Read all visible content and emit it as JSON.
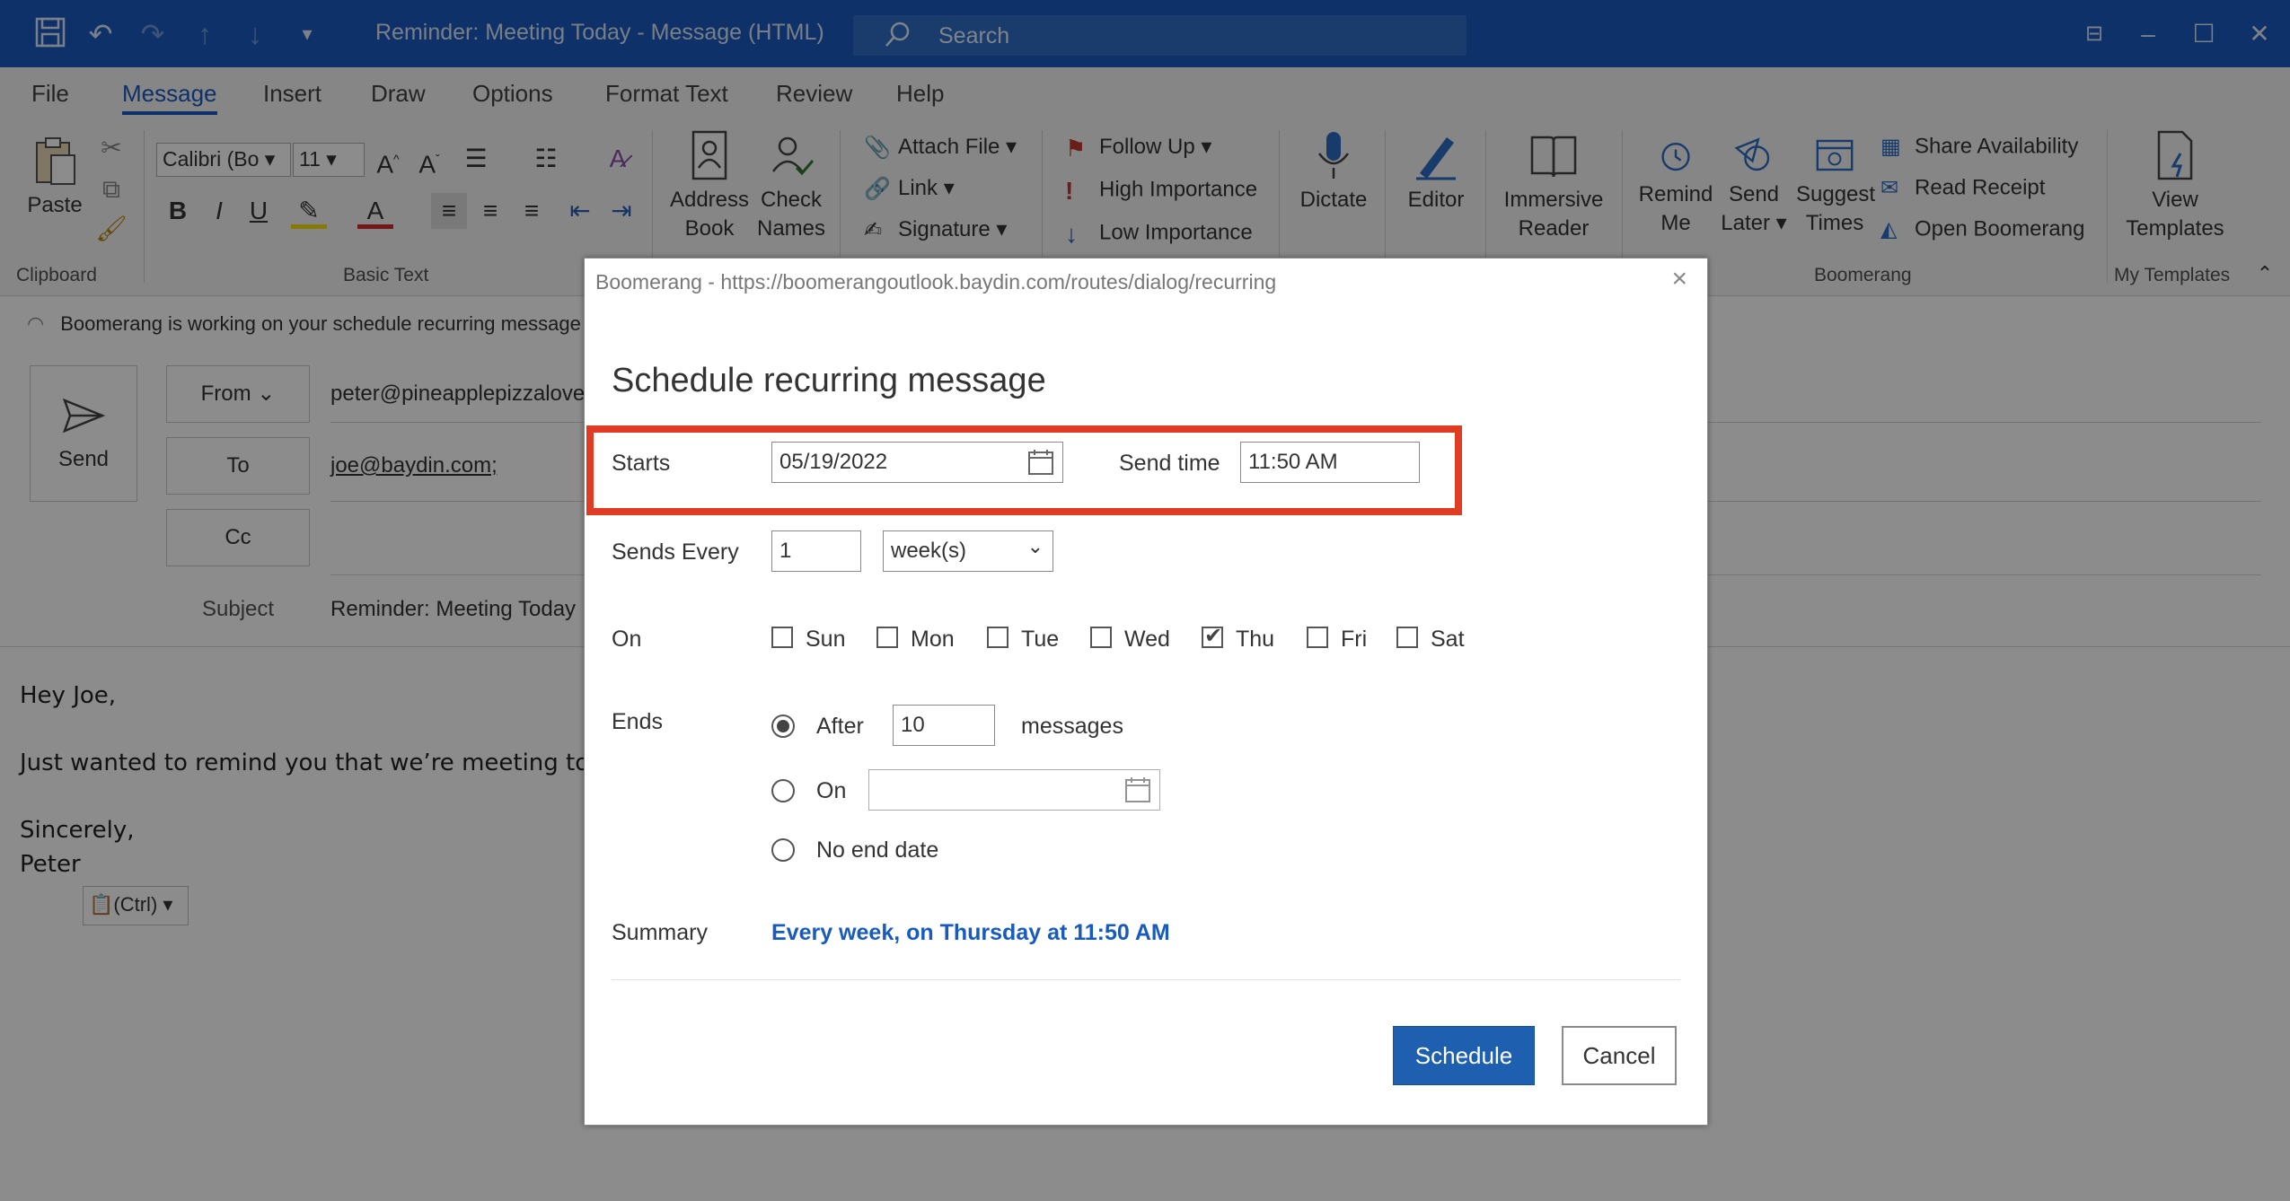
{
  "window": {
    "title": "Reminder: Meeting Today  -  Message (HTML)",
    "search_placeholder": "Search"
  },
  "menu": {
    "tabs": [
      "File",
      "Message",
      "Insert",
      "Draw",
      "Options",
      "Format Text",
      "Review",
      "Help"
    ],
    "active": "Message"
  },
  "ribbon": {
    "clipboard": {
      "paste": "Paste",
      "group": "Clipboard"
    },
    "basic_text": {
      "font_name": "Calibri (Bo",
      "font_size": "11",
      "group": "Basic Text"
    },
    "include": {
      "attach_file": "Attach File",
      "link": "Link",
      "signature": "Signature"
    },
    "names": {
      "address_book": "Address Book",
      "check_names": "Check Names"
    },
    "tags": {
      "follow_up": "Follow Up",
      "high_importance": "High Importance",
      "low_importance": "Low Importance"
    },
    "dictate": "Dictate",
    "editor": "Editor",
    "immersive_reader": "Immersive Reader",
    "boomerang": {
      "remind_me": "Remind Me",
      "send_later": "Send Later",
      "suggest_times": "Suggest Times",
      "share_availability": "Share Availability",
      "read_receipt": "Read Receipt",
      "open_boomerang": "Open Boomerang",
      "group": "Boomerang"
    },
    "templates": {
      "view_templates": "View Templates",
      "group": "My Templates"
    }
  },
  "compose": {
    "info": "Boomerang is working on your schedule recurring message",
    "send": "Send",
    "from_label": "From",
    "from_value": "peter@pineapplepizzalove",
    "to_label": "To",
    "to_value": "joe@baydin.com;",
    "cc_label": "Cc",
    "subject_label": "Subject",
    "subject_value": "Reminder: Meeting Today",
    "body": {
      "greeting": "Hey Joe,",
      "line1": "Just wanted to remind you that we’re meeting today",
      "closing": "Sincerely,",
      "name": "Peter"
    },
    "paste_options": "(Ctrl)"
  },
  "dialog": {
    "title": "Boomerang - https://boomerangoutlook.baydin.com/routes/dialog/recurring",
    "heading": "Schedule recurring message",
    "starts_label": "Starts",
    "starts_value": "05/19/2022",
    "send_time_label": "Send time",
    "send_time_value": "11:50 AM",
    "sends_every_label": "Sends Every",
    "sends_every_value": "1",
    "sends_every_unit": "week(s)",
    "on_label": "On",
    "days": [
      {
        "label": "Sun",
        "checked": false
      },
      {
        "label": "Mon",
        "checked": false
      },
      {
        "label": "Tue",
        "checked": false
      },
      {
        "label": "Wed",
        "checked": false
      },
      {
        "label": "Thu",
        "checked": true
      },
      {
        "label": "Fri",
        "checked": false
      },
      {
        "label": "Sat",
        "checked": false
      }
    ],
    "ends_label": "Ends",
    "ends_after_label": "After",
    "ends_after_value": "10",
    "ends_after_unit": "messages",
    "ends_on_label": "On",
    "ends_none_label": "No end date",
    "ends_selected": "After",
    "summary_label": "Summary",
    "summary_value": "Every week, on Thursday at 11:50 AM",
    "schedule_button": "Schedule",
    "cancel_button": "Cancel"
  },
  "colors": {
    "accent": "#185abd",
    "highlight": "#e03c23"
  }
}
